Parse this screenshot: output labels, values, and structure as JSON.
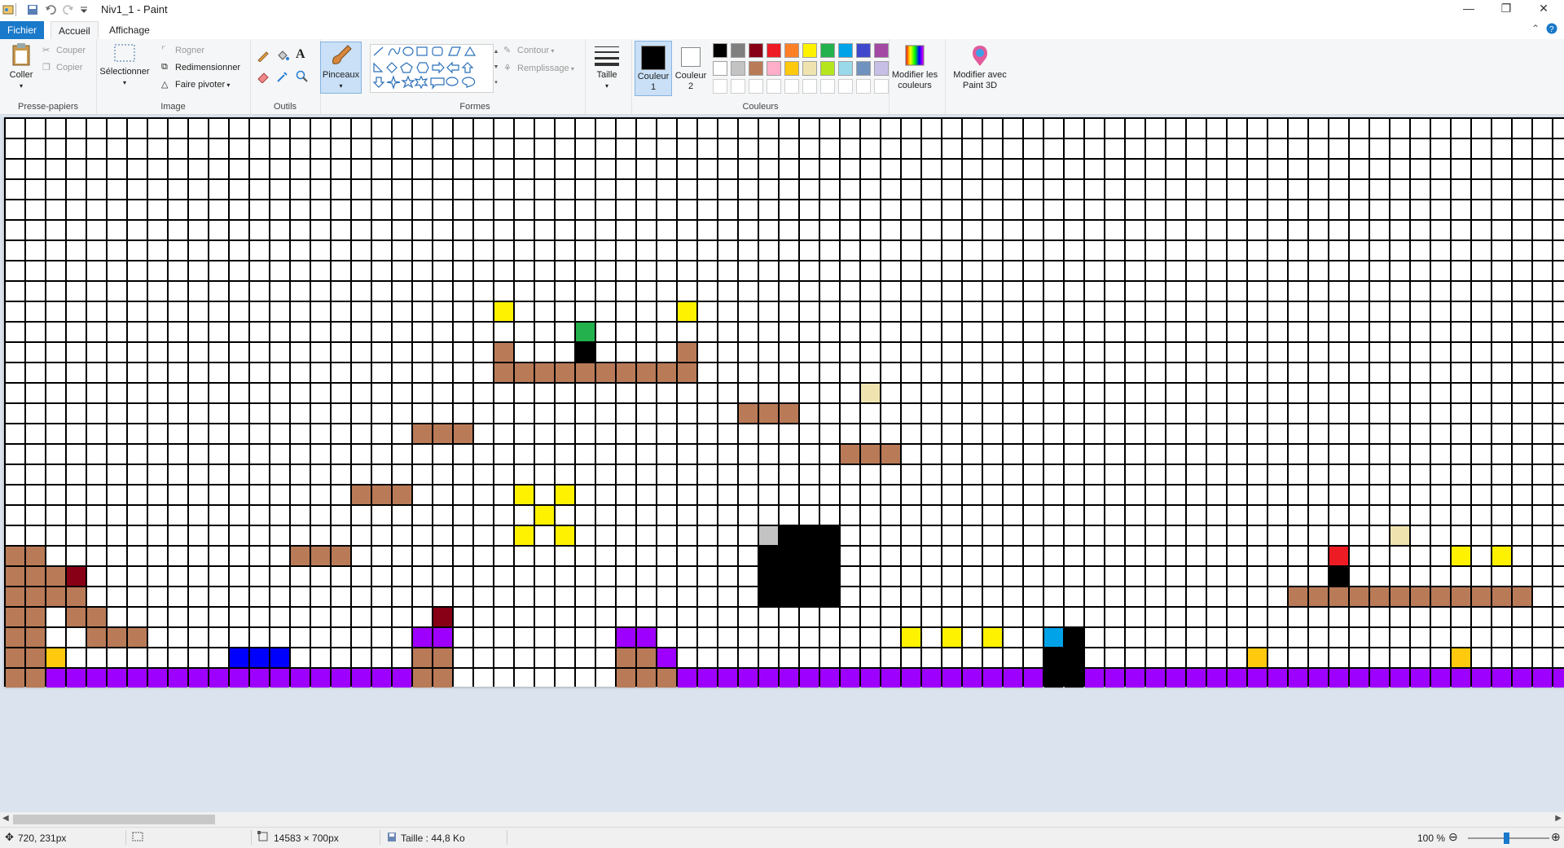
{
  "window": {
    "title": "Niv1_1 - Paint"
  },
  "tabs": [
    {
      "label": "Fichier"
    },
    {
      "label": "Accueil"
    },
    {
      "label": "Affichage"
    }
  ],
  "ribbon": {
    "clipboard": {
      "paste": "Coller",
      "cut": "Couper",
      "copy": "Copier",
      "group": "Presse-papiers"
    },
    "image": {
      "select": "Sélectionner",
      "crop": "Rogner",
      "resize": "Redimensionner",
      "rotate": "Faire pivoter",
      "group": "Image"
    },
    "tools": {
      "group": "Outils"
    },
    "brushes": {
      "label": "Pinceaux"
    },
    "shapes": {
      "outline": "Contour",
      "fill": "Remplissage",
      "group": "Formes"
    },
    "size": {
      "label": "Taille"
    },
    "colors": {
      "color1": "Couleur",
      "color1_num": "1",
      "color2": "Couleur",
      "color2_num": "2",
      "group": "Couleurs",
      "edit_line1": "Modifier les",
      "edit_line2": "couleurs",
      "paint3d_line1": "Modifier avec",
      "paint3d_line2": "Paint 3D",
      "palette_row1": [
        "#000000",
        "#7f7f7f",
        "#880015",
        "#ed1c24",
        "#ff7f27",
        "#fff200",
        "#22b14c",
        "#00a2e8",
        "#3f48cc",
        "#a349a4"
      ],
      "palette_row2": [
        "#ffffff",
        "#c3c3c3",
        "#b97a57",
        "#ffaec9",
        "#ffc90e",
        "#efe4b0",
        "#b5e61d",
        "#99d9ea",
        "#7092be",
        "#c8bfe7"
      ]
    }
  },
  "canvas": {
    "colors": {
      "B": "#b97a57",
      "Y": "#fff200",
      "G": "#22b14c",
      "K": "#000000",
      "T": "#efe4b0",
      "R": "#880015",
      "O": "#ffc90e",
      "N": "#0000ff",
      "P": "#9e00ff",
      "Q": "#a349a4",
      "S": "#c3c3c3",
      "E": "#ed1c24",
      "C": "#00a2e8"
    },
    "runs": [
      [
        9,
        24,
        1,
        "Y"
      ],
      [
        9,
        33,
        1,
        "Y"
      ],
      [
        10,
        28,
        1,
        "G"
      ],
      [
        11,
        24,
        1,
        "B"
      ],
      [
        11,
        28,
        1,
        "K"
      ],
      [
        11,
        33,
        1,
        "B"
      ],
      [
        12,
        24,
        10,
        "B"
      ],
      [
        13,
        42,
        1,
        "T"
      ],
      [
        14,
        36,
        3,
        "B"
      ],
      [
        15,
        20,
        3,
        "B"
      ],
      [
        16,
        41,
        3,
        "B"
      ],
      [
        18,
        17,
        3,
        "B"
      ],
      [
        18,
        25,
        1,
        "Y"
      ],
      [
        18,
        27,
        1,
        "Y"
      ],
      [
        19,
        26,
        1,
        "Y"
      ],
      [
        20,
        25,
        1,
        "Y"
      ],
      [
        20,
        27,
        1,
        "Y"
      ],
      [
        20,
        37,
        1,
        "S"
      ],
      [
        20,
        38,
        3,
        "K"
      ],
      [
        20,
        68,
        1,
        "T"
      ],
      [
        21,
        0,
        2,
        "B"
      ],
      [
        21,
        14,
        3,
        "B"
      ],
      [
        21,
        37,
        4,
        "K"
      ],
      [
        21,
        65,
        1,
        "E"
      ],
      [
        21,
        71,
        1,
        "Y"
      ],
      [
        21,
        73,
        1,
        "Y"
      ],
      [
        22,
        0,
        3,
        "B"
      ],
      [
        22,
        3,
        1,
        "R"
      ],
      [
        22,
        37,
        4,
        "K"
      ],
      [
        22,
        65,
        1,
        "K"
      ],
      [
        23,
        0,
        4,
        "B"
      ],
      [
        23,
        37,
        4,
        "K"
      ],
      [
        23,
        63,
        12,
        "B"
      ],
      [
        24,
        0,
        2,
        "B"
      ],
      [
        24,
        3,
        2,
        "B"
      ],
      [
        24,
        21,
        1,
        "R"
      ],
      [
        25,
        0,
        2,
        "B"
      ],
      [
        25,
        4,
        3,
        "B"
      ],
      [
        25,
        20,
        2,
        "P"
      ],
      [
        25,
        30,
        2,
        "P"
      ],
      [
        25,
        44,
        1,
        "Y"
      ],
      [
        25,
        46,
        1,
        "Y"
      ],
      [
        25,
        48,
        1,
        "Y"
      ],
      [
        25,
        51,
        1,
        "C"
      ],
      [
        25,
        52,
        1,
        "K"
      ],
      [
        26,
        0,
        2,
        "B"
      ],
      [
        26,
        2,
        1,
        "O"
      ],
      [
        26,
        11,
        3,
        "N"
      ],
      [
        26,
        20,
        2,
        "B"
      ],
      [
        26,
        30,
        2,
        "B"
      ],
      [
        26,
        32,
        1,
        "P"
      ],
      [
        26,
        51,
        2,
        "K"
      ],
      [
        26,
        61,
        1,
        "O"
      ],
      [
        26,
        71,
        1,
        "O"
      ],
      [
        27,
        0,
        2,
        "B"
      ],
      [
        27,
        2,
        18,
        "P"
      ],
      [
        27,
        20,
        2,
        "B"
      ],
      [
        27,
        30,
        3,
        "B"
      ],
      [
        27,
        33,
        18,
        "P"
      ],
      [
        27,
        51,
        2,
        "K"
      ],
      [
        27,
        53,
        24,
        "P"
      ]
    ]
  },
  "status": {
    "cursor": "720, 231px",
    "dimensions": "14583 × 700px",
    "size": "Taille : 44,8 Ko",
    "zoom": "100 %"
  }
}
